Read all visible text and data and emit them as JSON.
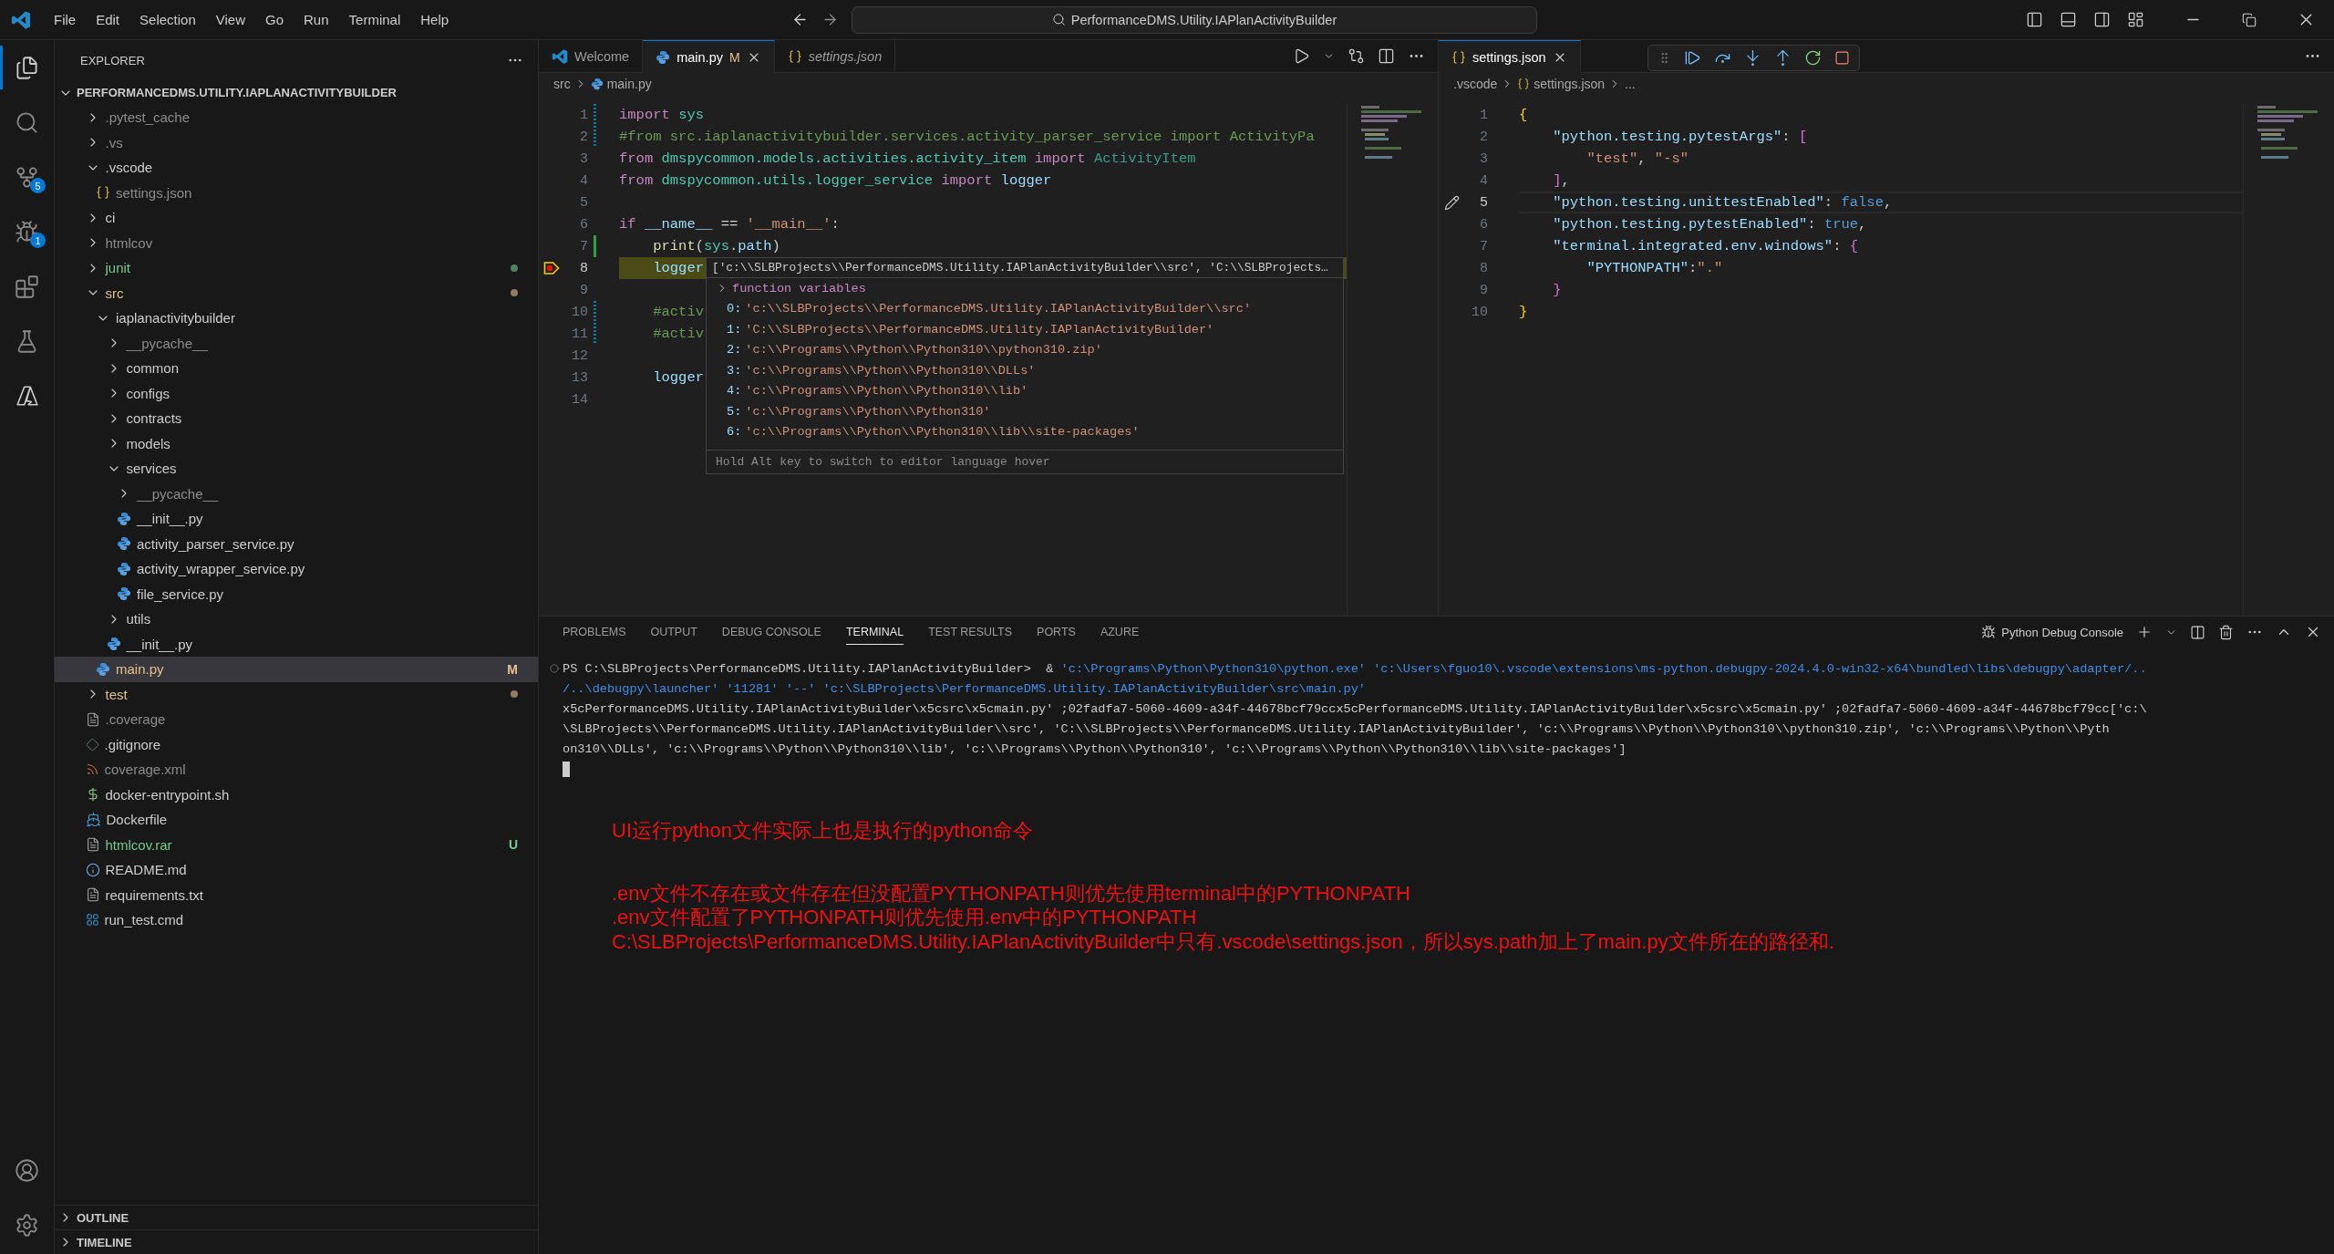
{
  "menu": [
    "File",
    "Edit",
    "Selection",
    "View",
    "Go",
    "Run",
    "Terminal",
    "Help"
  ],
  "title_bar": {
    "search": "PerformanceDMS.Utility.IAPlanActivityBuilder"
  },
  "activity_bar": {
    "items": [
      {
        "kind": "explorer",
        "selected": true
      },
      {
        "kind": "search",
        "selected": false
      },
      {
        "kind": "source_control",
        "selected": false,
        "badge": "5"
      },
      {
        "kind": "debug",
        "selected": false,
        "badge": "1"
      },
      {
        "kind": "extensions",
        "selected": false
      },
      {
        "kind": "testing",
        "selected": false
      },
      {
        "kind": "azure",
        "selected": false
      }
    ],
    "bottom": [
      {
        "kind": "account"
      },
      {
        "kind": "settings"
      }
    ]
  },
  "sidebar": {
    "title": "EXPLORER",
    "root": {
      "label": "PERFORMANCEDMS.UTILITY.IAPLANACTIVITYBUILDER",
      "expanded": true,
      "items": [
        {
          "kind": "folder",
          "label": ".pytest_cache",
          "expanded": false,
          "color": "#8c8c8c",
          "dot": false,
          "selected": false
        },
        {
          "kind": "folder",
          "label": ".vs",
          "expanded": false,
          "color": "#8c8c8c",
          "dot": false,
          "selected": false
        },
        {
          "kind": "folder",
          "label": ".vscode",
          "expanded": true,
          "color": "#cccccc",
          "dot": false,
          "selected": false,
          "children": [
            {
              "kind": "json",
              "label": "settings.json",
              "color": "#8c8c8c",
              "dot": false,
              "selected": false
            }
          ]
        },
        {
          "kind": "folder",
          "label": "ci",
          "expanded": false,
          "color": "#cccccc",
          "dot": false,
          "selected": false
        },
        {
          "kind": "folder",
          "label": "htmlcov",
          "expanded": false,
          "color": "#8c8c8c",
          "dot": false,
          "selected": false
        },
        {
          "kind": "folder",
          "label": "junit",
          "expanded": false,
          "color": "#73c991",
          "dot": true,
          "selected": false
        },
        {
          "kind": "folder",
          "label": "src",
          "expanded": true,
          "color": "#e2c08d",
          "dot": true,
          "selected": false,
          "children": [
            {
              "kind": "folder",
              "label": "iaplanactivitybuilder",
              "expanded": true,
              "color": "#cccccc",
              "dot": false,
              "selected": false,
              "children": [
                {
                  "kind": "folder",
                  "label": "__pycache__",
                  "expanded": false,
                  "color": "#8c8c8c",
                  "dot": false,
                  "selected": false
                },
                {
                  "kind": "folder",
                  "label": "common",
                  "expanded": false,
                  "color": "#cccccc",
                  "dot": false,
                  "selected": false
                },
                {
                  "kind": "folder",
                  "label": "configs",
                  "expanded": false,
                  "color": "#cccccc",
                  "dot": false,
                  "selected": false
                },
                {
                  "kind": "folder",
                  "label": "contracts",
                  "expanded": false,
                  "color": "#cccccc",
                  "dot": false,
                  "selected": false
                },
                {
                  "kind": "folder",
                  "label": "models",
                  "expanded": false,
                  "color": "#cccccc",
                  "dot": false,
                  "selected": false
                },
                {
                  "kind": "folder",
                  "label": "services",
                  "expanded": true,
                  "color": "#cccccc",
                  "dot": false,
                  "selected": false,
                  "children": [
                    {
                      "kind": "folder",
                      "label": "__pycache__",
                      "expanded": false,
                      "color": "#8c8c8c",
                      "dot": false,
                      "selected": false
                    },
                    {
                      "kind": "python",
                      "label": "__init__.py",
                      "color": "#cccccc",
                      "dot": false,
                      "selected": false
                    },
                    {
                      "kind": "python",
                      "label": "activity_parser_service.py",
                      "color": "#cccccc",
                      "dot": false,
                      "selected": false
                    },
                    {
                      "kind": "python",
                      "label": "activity_wrapper_service.py",
                      "color": "#cccccc",
                      "dot": false,
                      "selected": false
                    },
                    {
                      "kind": "python",
                      "label": "file_service.py",
                      "color": "#cccccc",
                      "dot": false,
                      "selected": false
                    }
                  ]
                },
                {
                  "kind": "folder",
                  "label": "utils",
                  "expanded": false,
                  "color": "#cccccc",
                  "dot": false,
                  "selected": false
                },
                {
                  "kind": "python",
                  "label": "__init__.py",
                  "color": "#cccccc",
                  "dot": false,
                  "selected": false
                }
              ]
            },
            {
              "kind": "python",
              "label": "main.py",
              "color": "#e2c08d",
              "dot": false,
              "badge": "M",
              "selected": true
            }
          ]
        },
        {
          "kind": "folder",
          "label": "test",
          "expanded": false,
          "color": "#e2c08d",
          "dot": true,
          "selected": false
        },
        {
          "kind": "text",
          "label": ".coverage",
          "color": "#8c8c8c",
          "dot": false,
          "selected": false
        },
        {
          "kind": "git",
          "label": ".gitignore",
          "color": "#cccccc",
          "dot": false,
          "selected": false
        },
        {
          "kind": "xml",
          "label": "coverage.xml",
          "color": "#8c8c8c",
          "dot": false,
          "selected": false
        },
        {
          "kind": "shell",
          "label": "docker-entrypoint.sh",
          "color": "#cccccc",
          "dot": false,
          "selected": false
        },
        {
          "kind": "docker",
          "label": "Dockerfile",
          "color": "#cccccc",
          "dot": false,
          "selected": false
        },
        {
          "kind": "text",
          "label": "htmlcov.rar",
          "color": "#73c991",
          "dot": false,
          "badge": "U",
          "selected": false
        },
        {
          "kind": "info",
          "label": "README.md",
          "color": "#cccccc",
          "dot": false,
          "selected": false
        },
        {
          "kind": "text",
          "label": "requirements.txt",
          "color": "#cccccc",
          "dot": false,
          "selected": false
        },
        {
          "kind": "windows",
          "label": "run_test.cmd",
          "color": "#cccccc",
          "dot": false,
          "selected": false
        }
      ]
    },
    "sections": [
      {
        "label": "OUTLINE",
        "expanded": false
      },
      {
        "label": "TIMELINE",
        "expanded": false
      }
    ]
  },
  "editors": [
    {
      "kind": "debug",
      "tabs": [
        {
          "label": "Welcome",
          "kind": "welcome",
          "selected": false,
          "preview": false
        },
        {
          "label": "main.py",
          "kind": "python",
          "badge": "M",
          "selected": true,
          "preview": false
        },
        {
          "label": "settings.json",
          "kind": "json",
          "selected": false,
          "preview": true
        }
      ],
      "breadcrumb": [
        {
          "label": "src",
          "kind": "folder"
        },
        {
          "label": "main.py",
          "kind": "python"
        }
      ],
      "lines": [
        {
          "number": "1",
          "kind": "modified",
          "current": false,
          "tokens": [
            {
              "t": "import ",
              "kind": "kw"
            },
            {
              "t": "sys",
              "kind": "mod"
            }
          ]
        },
        {
          "number": "2",
          "kind": "modified",
          "current": false,
          "tokens": [
            {
              "t": "#from src.iaplanactivitybuilder.services.activity_parser_service import ActivityPa",
              "kind": "cmt"
            }
          ]
        },
        {
          "number": "3",
          "kind": "plain",
          "current": false,
          "tokens": [
            {
              "t": "from ",
              "kind": "kw"
            },
            {
              "t": "dmspycommon.models.activities.activity_item ",
              "kind": "mod"
            },
            {
              "t": "import ",
              "kind": "kw"
            },
            {
              "t": "ActivityItem",
              "kind": "cls"
            }
          ]
        },
        {
          "number": "4",
          "kind": "plain",
          "current": false,
          "tokens": [
            {
              "t": "from ",
              "kind": "kw"
            },
            {
              "t": "dmspycommon.utils.logger_service ",
              "kind": "mod"
            },
            {
              "t": "import ",
              "kind": "kw"
            },
            {
              "t": "logger",
              "kind": "var"
            }
          ]
        },
        {
          "number": "5",
          "kind": "plain",
          "current": false
        },
        {
          "number": "6",
          "kind": "plain",
          "current": false,
          "tokens": [
            {
              "t": "if ",
              "kind": "kw"
            },
            {
              "t": "__name__",
              "kind": "var"
            },
            {
              "t": " == "
            },
            {
              "t": "'__main__'",
              "kind": "str"
            },
            {
              "t": ":"
            }
          ]
        },
        {
          "number": "7",
          "kind": "added",
          "current": false,
          "tokens": [
            {
              "t": "    print",
              "kind": "fn"
            },
            {
              "t": "("
            },
            {
              "t": "sys",
              "kind": "mod"
            },
            {
              "t": "."
            },
            {
              "t": "path",
              "kind": "var"
            },
            {
              "t": ")"
            }
          ]
        },
        {
          "number": "8",
          "kind": "plain",
          "breakpoint": true,
          "current": true,
          "tokens": [
            {
              "t": "    logger",
              "kind": "var"
            }
          ]
        },
        {
          "number": "9",
          "kind": "plain",
          "current": false
        },
        {
          "number": "10",
          "kind": "modified",
          "current": false,
          "tokens": [
            {
              "t": "    #activ",
              "kind": "cmt"
            }
          ]
        },
        {
          "number": "11",
          "kind": "modified",
          "current": false,
          "tokens": [
            {
              "t": "    #activ",
              "kind": "cmt"
            }
          ]
        },
        {
          "number": "12",
          "kind": "plain",
          "current": false
        },
        {
          "number": "13",
          "kind": "plain",
          "current": false,
          "tokens": [
            {
              "t": "    logger",
              "kind": "var"
            }
          ]
        },
        {
          "number": "14",
          "kind": "plain",
          "current": false
        }
      ],
      "hover": {
        "header": "['c:\\\\SLBProjects\\\\PerformanceDMS.Utility.IAPlanActivityBuilder\\\\src', 'C:\\\\SLBProjects…",
        "group": "function variables",
        "expanded": false,
        "items": [
          {
            "index": "0:",
            "value": "'c:\\\\SLBProjects\\\\PerformanceDMS.Utility.IAPlanActivityBuilder\\\\src'"
          },
          {
            "index": "1:",
            "value": "'C:\\\\SLBProjects\\\\PerformanceDMS.Utility.IAPlanActivityBuilder'"
          },
          {
            "index": "2:",
            "value": "'c:\\\\Programs\\\\Python\\\\Python310\\\\python310.zip'"
          },
          {
            "index": "3:",
            "value": "'c:\\\\Programs\\\\Python\\\\Python310\\\\DLLs'"
          },
          {
            "index": "4:",
            "value": "'c:\\\\Programs\\\\Python\\\\Python310\\\\lib'"
          },
          {
            "index": "5:",
            "value": "'c:\\\\Programs\\\\Python\\\\Python310'"
          },
          {
            "index": "6:",
            "value": "'c:\\\\Programs\\\\Python\\\\Python310\\\\lib\\\\site-packages'"
          }
        ],
        "footer": "Hold Alt key to switch to editor language hover"
      }
    },
    {
      "kind": "cursor",
      "tabs": [
        {
          "label": "settings.json",
          "kind": "json",
          "selected": true,
          "preview": false
        }
      ],
      "breadcrumb": [
        {
          "label": ".vscode",
          "kind": "plain"
        },
        {
          "label": "settings.json",
          "kind": "json"
        },
        {
          "label": "...",
          "kind": "plain"
        }
      ],
      "lines": [
        {
          "number": "1",
          "current": false,
          "tokens": [
            {
              "t": "{",
              "kind": "br1"
            }
          ]
        },
        {
          "number": "2",
          "current": false,
          "tokens": [
            {
              "t": "    \"python.testing.pytestArgs\"",
              "kind": "key"
            },
            {
              "t": ": "
            },
            {
              "t": "[",
              "kind": "br2"
            }
          ]
        },
        {
          "number": "3",
          "current": false,
          "tokens": [
            {
              "t": "        \"test\"",
              "kind": "str"
            },
            {
              "t": ", "
            },
            {
              "t": "\"-s\"",
              "kind": "str"
            }
          ]
        },
        {
          "number": "4",
          "current": false,
          "tokens": [
            {
              "t": "    ]",
              "kind": "br2"
            },
            {
              "t": ","
            }
          ]
        },
        {
          "number": "5",
          "edited": true,
          "current": true,
          "tokens": [
            {
              "t": "    \"python.testing.unittestEnabled\"",
              "kind": "key"
            },
            {
              "t": ": "
            },
            {
              "t": "false",
              "kind": "bool"
            },
            {
              "t": ","
            }
          ]
        },
        {
          "number": "6",
          "current": false,
          "tokens": [
            {
              "t": "    \"python.testing.pytestEnabled\"",
              "kind": "key"
            },
            {
              "t": ": "
            },
            {
              "t": "true",
              "kind": "bool"
            },
            {
              "t": ","
            }
          ]
        },
        {
          "number": "7",
          "current": false,
          "tokens": [
            {
              "t": "    \"terminal.integrated.env.windows\"",
              "kind": "key"
            },
            {
              "t": ": "
            },
            {
              "t": "{",
              "kind": "br2"
            }
          ]
        },
        {
          "number": "8",
          "current": false,
          "tokens": [
            {
              "t": "        \"PYTHONPATH\"",
              "kind": "key"
            },
            {
              "t": ":"
            },
            {
              "t": "\".\"",
              "kind": "str"
            }
          ]
        },
        {
          "number": "9",
          "current": false,
          "tokens": [
            {
              "t": "    }",
              "kind": "br2"
            }
          ]
        },
        {
          "number": "10",
          "current": false,
          "tokens": [
            {
              "t": "}",
              "kind": "br1"
            }
          ]
        }
      ]
    }
  ],
  "panel": {
    "tabs": [
      {
        "label": "PROBLEMS",
        "selected": false
      },
      {
        "label": "OUTPUT",
        "selected": false
      },
      {
        "label": "DEBUG CONSOLE",
        "selected": false
      },
      {
        "label": "TERMINAL",
        "selected": true
      },
      {
        "label": "TEST RESULTS",
        "selected": false
      },
      {
        "label": "PORTS",
        "selected": false
      },
      {
        "label": "AZURE",
        "selected": false
      }
    ],
    "terminal_name": "Python Debug Console",
    "terminal_lines": [
      {
        "decorated": true,
        "tokens": [
          {
            "t": "PS C:\\SLBProjects\\PerformanceDMS.Utility.IAPlanActivityBuilder>  & "
          },
          {
            "t": "'c:\\Programs\\Python\\Python310\\python.exe' 'c:\\Users\\fguo10\\.vscode\\extensions\\ms-python.debugpy-2024.4.0-win32-x64\\bundled\\libs\\debugpy\\adapter/..",
            "kind": "link"
          }
        ]
      },
      {
        "decorated": false,
        "tokens": [
          {
            "t": "/..\\debugpy\\launcher' '11281' '--' 'c:\\SLBProjects\\PerformanceDMS.Utility.IAPlanActivityBuilder\\src\\main.py'",
            "kind": "link"
          }
        ]
      },
      {
        "decorated": false,
        "tokens": [
          {
            "t": "x5cPerformanceDMS.Utility.IAPlanActivityBuilder\\x5csrc\\x5cmain.py' ;02fadfa7-5060-4609-a34f-44678bcf79ccx5cPerformanceDMS.Utility.IAPlanActivityBuilder\\x5csrc\\x5cmain.py' ;02fadfa7-5060-4609-a34f-44678bcf79cc['c:\\"
          }
        ]
      },
      {
        "decorated": false,
        "tokens": [
          {
            "t": "\\SLBProjects\\\\PerformanceDMS.Utility.IAPlanActivityBuilder\\\\src', 'C:\\\\SLBProjects\\\\PerformanceDMS.Utility.IAPlanActivityBuilder', 'c:\\\\Programs\\\\Python\\\\Python310\\\\python310.zip', 'c:\\\\Programs\\\\Python\\\\Pyth"
          }
        ]
      },
      {
        "decorated": false,
        "tokens": [
          {
            "t": "on310\\\\DLLs', 'c:\\\\Programs\\\\Python\\\\Python310\\\\lib', 'c:\\\\Programs\\\\Python\\\\Python310', 'c:\\\\Programs\\\\Python\\\\Python310\\\\lib\\\\site-packages']"
          }
        ]
      }
    ],
    "annotations": [
      [
        "UI运行python文件实际上也是执行的python命令"
      ],
      [
        ".env文件不存在或文件存在但没配置PYTHONPATH则优先使用terminal中的PYTHONPATH",
        ".env文件配置了PYTHONPATH则优先使用.env中的PYTHONPATH",
        "C:\\SLBProjects\\PerformanceDMS.Utility.IAPlanActivityBuilder中只有.vscode\\settings.json，所以sys.path加上了main.py文件所在的路径和."
      ]
    ]
  }
}
